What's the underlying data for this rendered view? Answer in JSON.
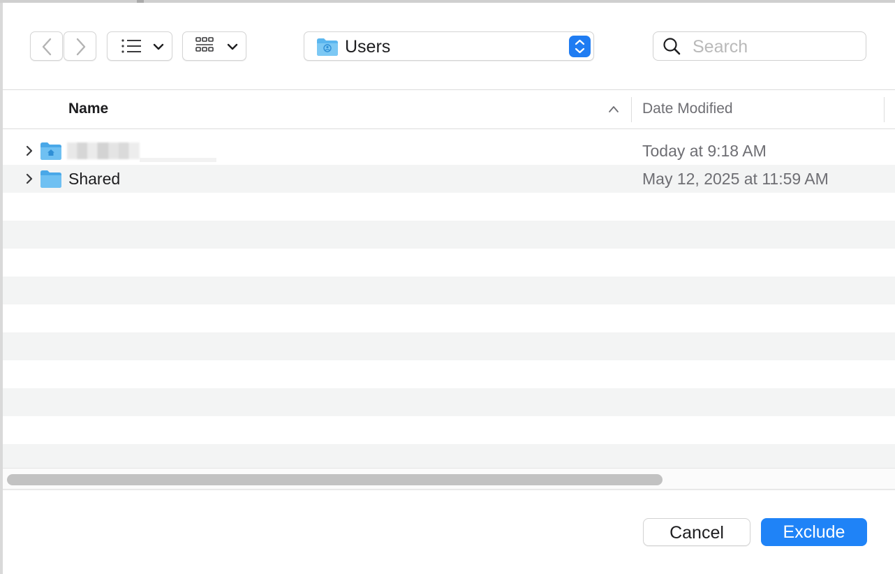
{
  "toolbar": {
    "back_icon": "chevron-left-icon",
    "forward_icon": "chevron-right-icon",
    "list_view_icon": "list-view-icon",
    "group_icon": "grid-icon",
    "path": {
      "label": "Users",
      "icon": "user-folder-icon"
    },
    "search": {
      "placeholder": "Search",
      "value": ""
    }
  },
  "table": {
    "columns": {
      "name": "Name",
      "date_modified": "Date Modified"
    },
    "rows": [
      {
        "name": "",
        "date": "Today at 9:18 AM",
        "icon": "home-folder-icon",
        "redacted": true
      },
      {
        "name": "Shared",
        "date": "May 12, 2025 at 11:59 AM",
        "icon": "folder-icon"
      }
    ]
  },
  "buttons": {
    "cancel": "Cancel",
    "exclude": "Exclude"
  },
  "colors": {
    "accent": "#1f83f7",
    "folder": "#5ab6ef",
    "row_alt": "#f3f4f4"
  }
}
